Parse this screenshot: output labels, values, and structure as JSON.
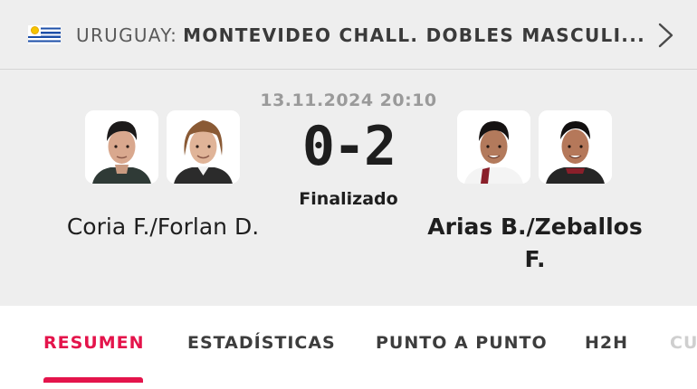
{
  "header": {
    "flag_icon": "uruguay-flag-icon",
    "country": "URUGUAY",
    "separator": ":",
    "tournament": "MONTEVIDEO CHALL. DOBLES MASCULI...",
    "next_icon": "chevron-right-icon"
  },
  "match": {
    "datetime": "13.11.2024 20:10",
    "score": "0-2",
    "status": "Finalizado",
    "home": {
      "name": "Coria F./Forlan D."
    },
    "away": {
      "name": "Arias B./Zeballos F."
    }
  },
  "tabs": [
    {
      "label": "RESUMEN",
      "active": true
    },
    {
      "label": "ESTADÍSTICAS",
      "active": false
    },
    {
      "label": "PUNTO A PUNTO",
      "active": false
    },
    {
      "label": "H2H",
      "active": false
    },
    {
      "label": "CU",
      "active": false
    }
  ],
  "colors": {
    "accent": "#e4144b",
    "background": "#eeeeee",
    "text": "#1e1e1e",
    "muted": "#9a9a9a"
  }
}
